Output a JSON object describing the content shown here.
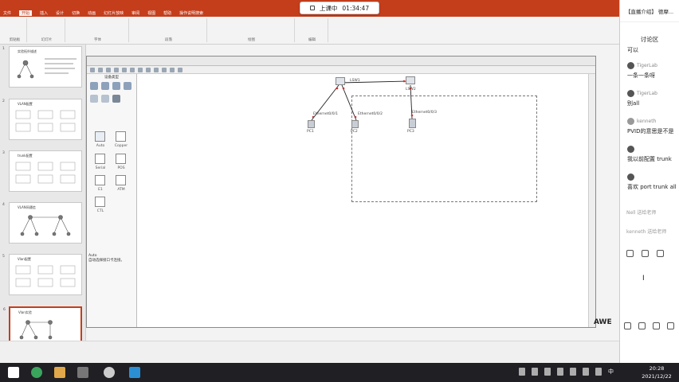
{
  "ppt": {
    "tabs": [
      "文件",
      "开始",
      "插入",
      "设计",
      "切换",
      "动画",
      "幻灯片放映",
      "审阅",
      "视图",
      "帮助",
      "操作说明搜索"
    ],
    "active_tab": "开始",
    "groups": [
      "剪贴板",
      "幻灯片",
      "字体",
      "段落",
      "绘图",
      "编辑"
    ]
  },
  "timer": {
    "label": "上课中",
    "time": "01:34:47"
  },
  "slides": [
    {
      "num": "1",
      "title": "实验拓扑描述"
    },
    {
      "num": "2",
      "title": "VLAN配置"
    },
    {
      "num": "3",
      "title": "trunk配置"
    },
    {
      "num": "4",
      "title": "VLAN间通信"
    },
    {
      "num": "5",
      "title": "Vlan配置"
    },
    {
      "num": "6",
      "title": "Vlan实验"
    }
  ],
  "ensp": {
    "panel_header": "设备类型",
    "cables": [
      {
        "label": "Auto"
      },
      {
        "label": "Copper"
      },
      {
        "label": "Serial"
      },
      {
        "label": "POS"
      },
      {
        "label": "E1"
      },
      {
        "label": "ATM"
      },
      {
        "label": "CTL"
      }
    ],
    "desc_title": "Auto",
    "desc_text": "自动选择接口卡连接。",
    "nodes": {
      "lsw1": "LSW1",
      "lsw2": "LSW2",
      "pc1": "PC1",
      "pc2": "PC2",
      "pc3": "PC3",
      "e1": "Ethernet0/0/1",
      "e2": "Ethernet0/0/2",
      "e3": "Ethernet0/0/3"
    }
  },
  "chat": {
    "header": "【直播介绍】 德摩...",
    "title": "讨论区",
    "messages": [
      {
        "user": "Tigerlab",
        "text": "可以"
      },
      {
        "user": "TigerLab",
        "text": "一条一条呀"
      },
      {
        "user": "TigerLab",
        "text": "别all"
      },
      {
        "user": "kenneth",
        "text": "PVID的意思是不是"
      },
      {
        "user": "",
        "text": "我以前配置 trunk"
      },
      {
        "user": "",
        "text": "喜欢 port trunk all"
      }
    ],
    "notes": [
      "Nell 送给老师",
      "kenneth 送给老师"
    ]
  },
  "taskbar": {
    "time": "20:28",
    "date": "2021/12/22",
    "ime": "中"
  },
  "watermark": "AWE"
}
